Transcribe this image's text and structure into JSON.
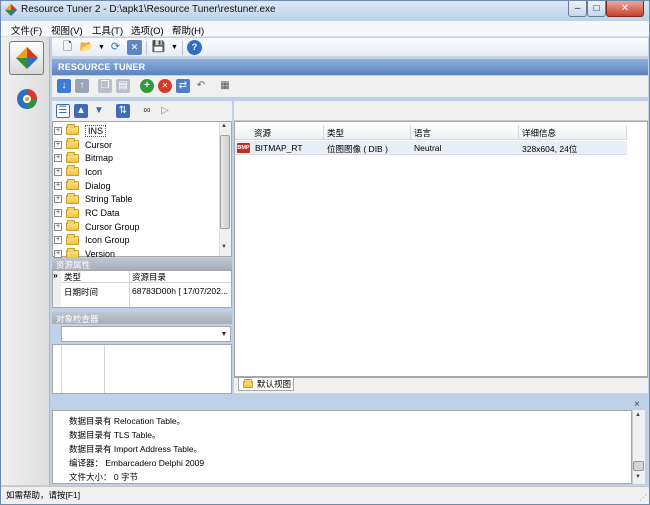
{
  "window": {
    "title": "Resource Tuner 2 - D:\\apk1\\Resource Tuner\\restuner.exe",
    "buttons": {
      "minimize": "–",
      "maximize": "□",
      "close": "✕"
    }
  },
  "menu": [
    {
      "label": "文件(F)"
    },
    {
      "label": "视图(V)"
    },
    {
      "label": "工具(T)"
    },
    {
      "label": "选项(O)"
    },
    {
      "label": "帮助(H)"
    }
  ],
  "banner": {
    "title": "RESOURCE TUNER"
  },
  "tree": {
    "items": [
      {
        "label": "INS"
      },
      {
        "label": "Cursor"
      },
      {
        "label": "Bitmap"
      },
      {
        "label": "Icon"
      },
      {
        "label": "Dialog"
      },
      {
        "label": "String Table"
      },
      {
        "label": "RC Data"
      },
      {
        "label": "Cursor Group"
      },
      {
        "label": "Icon Group"
      },
      {
        "label": "Version"
      }
    ]
  },
  "properties": {
    "header": "资源属性",
    "rows": [
      {
        "marker": "»",
        "key": "类型",
        "value": "资源目录"
      },
      {
        "marker": "",
        "key": "日期时间",
        "value": "68783D00h [ 17/07/202..."
      }
    ]
  },
  "object_inspector": {
    "header": "对象检查器",
    "combo_value": ""
  },
  "table": {
    "columns": [
      "资源",
      "类型",
      "语言",
      "详细信息"
    ],
    "rows": [
      {
        "icon_text": "BMP",
        "resource": "BITMAP_RT",
        "type": "位图图像 ( DIB )",
        "language": "Neutral",
        "details": "328x604, 24位"
      }
    ]
  },
  "tabs": [
    {
      "label": "默认视图"
    }
  ],
  "log": {
    "lines": [
      "数据目录有 Relocation Table。",
      "数据目录有 TLS Table。",
      "数据目录有 Import Address Table。",
      "编译器： Embarcadero Delphi 2009",
      "文件大小： 0 字节"
    ],
    "close": "×"
  },
  "status": {
    "text": "如需帮助，请按[F1]"
  },
  "colors": {
    "banner": "#5c83be",
    "selected_row": "#e7eef8",
    "close_button": "#c4422c"
  }
}
